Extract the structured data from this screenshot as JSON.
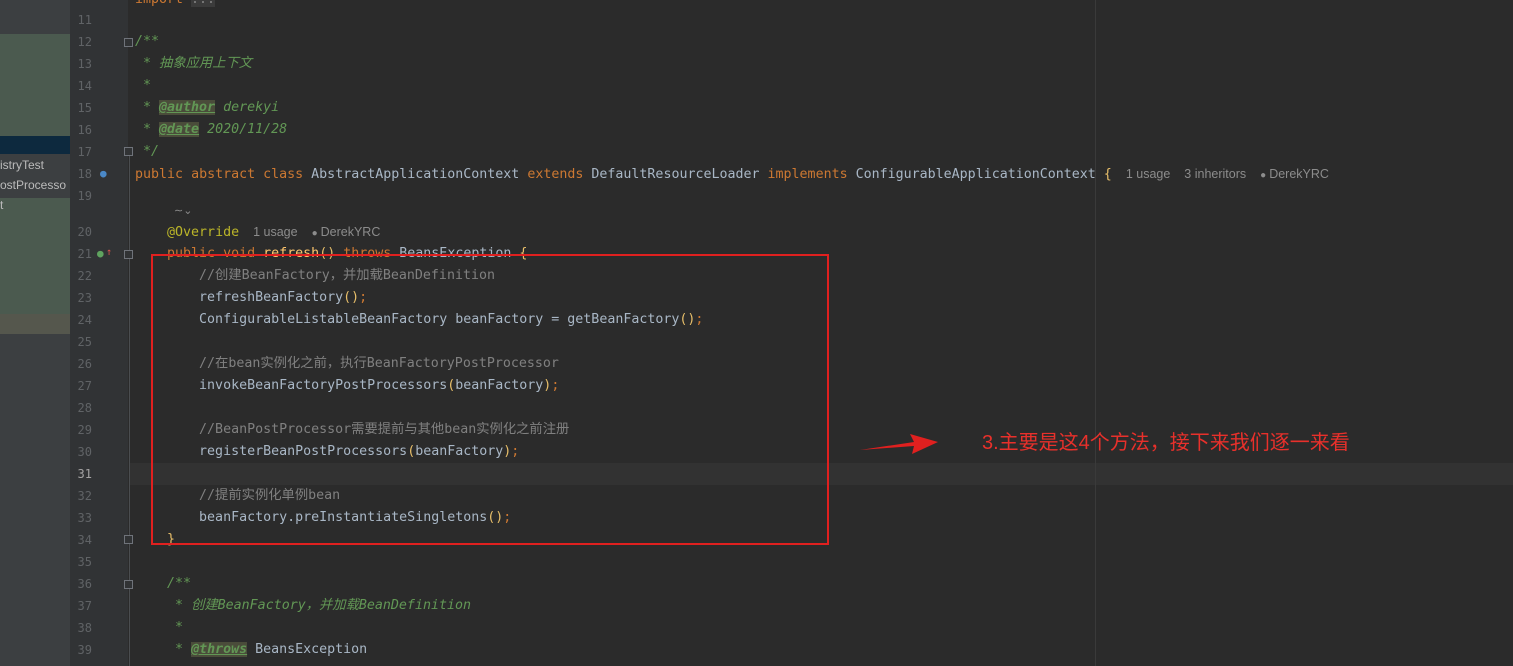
{
  "sidebar": {
    "items": [
      "istryTest",
      "ostProcesso",
      "t"
    ]
  },
  "gutter": {
    "line_numbers": [
      "11",
      "12",
      "13",
      "14",
      "15",
      "16",
      "17",
      "18",
      "19",
      "20",
      "21",
      "22",
      "23",
      "24",
      "25",
      "26",
      "27",
      "28",
      "29",
      "30",
      "31",
      "32",
      "33",
      "34",
      "35",
      "36",
      "37",
      "38",
      "39"
    ],
    "current_line": "31"
  },
  "code": {
    "line10_frag": "import ...",
    "l12": "/**",
    "l13": " * 抽象应用上下文",
    "l14": " *",
    "l15_star": " * ",
    "l15_tag": "@author",
    "l15_val": " derekyi",
    "l16_star": " * ",
    "l16_tag": "@date",
    "l16_val": " 2020/11/28",
    "l17": " */",
    "l18_public": "public",
    "l18_abstract": "abstract",
    "l18_class": "class",
    "l18_name": "AbstractApplicationContext",
    "l18_extends": "extends",
    "l18_super": "DefaultResourceLoader",
    "l18_implements": "implements",
    "l18_iface": "ConfigurableApplicationContext",
    "l18_brace": "{",
    "l18_hint_usage": "1 usage",
    "l18_hint_inheritors": "3 inheritors",
    "l18_hint_author": "DerekYRC",
    "l20_annotation": "@Override",
    "l20_hint_usage": "1 usage",
    "l20_hint_author": "DerekYRC",
    "l21_public": "public",
    "l21_void": "void",
    "l21_method": "refresh",
    "l21_paren": "()",
    "l21_throws": "throws",
    "l21_exc": "BeansException",
    "l21_brace": "{",
    "l22": "//创建BeanFactory，并加载BeanDefinition",
    "l23_call": "refreshBeanFactory",
    "l23_paren": "()",
    "l23_semi": ";",
    "l24_text": "ConfigurableListableBeanFactory beanFactory = getBeanFactory",
    "l24_paren": "()",
    "l24_semi": ";",
    "l26": "//在bean实例化之前，执行BeanFactoryPostProcessor",
    "l27_call": "invokeBeanFactoryPostProcessors",
    "l27_open": "(",
    "l27_arg": "beanFactory",
    "l27_close": ")",
    "l27_semi": ";",
    "l29": "//BeanPostProcessor需要提前与其他bean实例化之前注册",
    "l30_call": "registerBeanPostProcessors",
    "l30_open": "(",
    "l30_arg": "beanFactory",
    "l30_close": ")",
    "l30_semi": ";",
    "l32": "//提前实例化单例bean",
    "l33_text": "beanFactory.preInstantiateSingletons",
    "l33_paren": "()",
    "l33_semi": ";",
    "l34": "}",
    "l36": "/**",
    "l37_star": " * ",
    "l37_text": "创建BeanFactory，并加载BeanDefinition",
    "l38": " *",
    "l39_star": " * ",
    "l39_tag": "@throws",
    "l39_val": " BeansException"
  },
  "annotation": {
    "text": "3.主要是这4个方法，接下来我们逐一来看",
    "color": "#e8302b"
  },
  "icons": {
    "inlay_icon": "ai-assist-icon",
    "override_marker": "override-gutter-icon",
    "implemented_marker": "implemented-gutter-icon"
  }
}
